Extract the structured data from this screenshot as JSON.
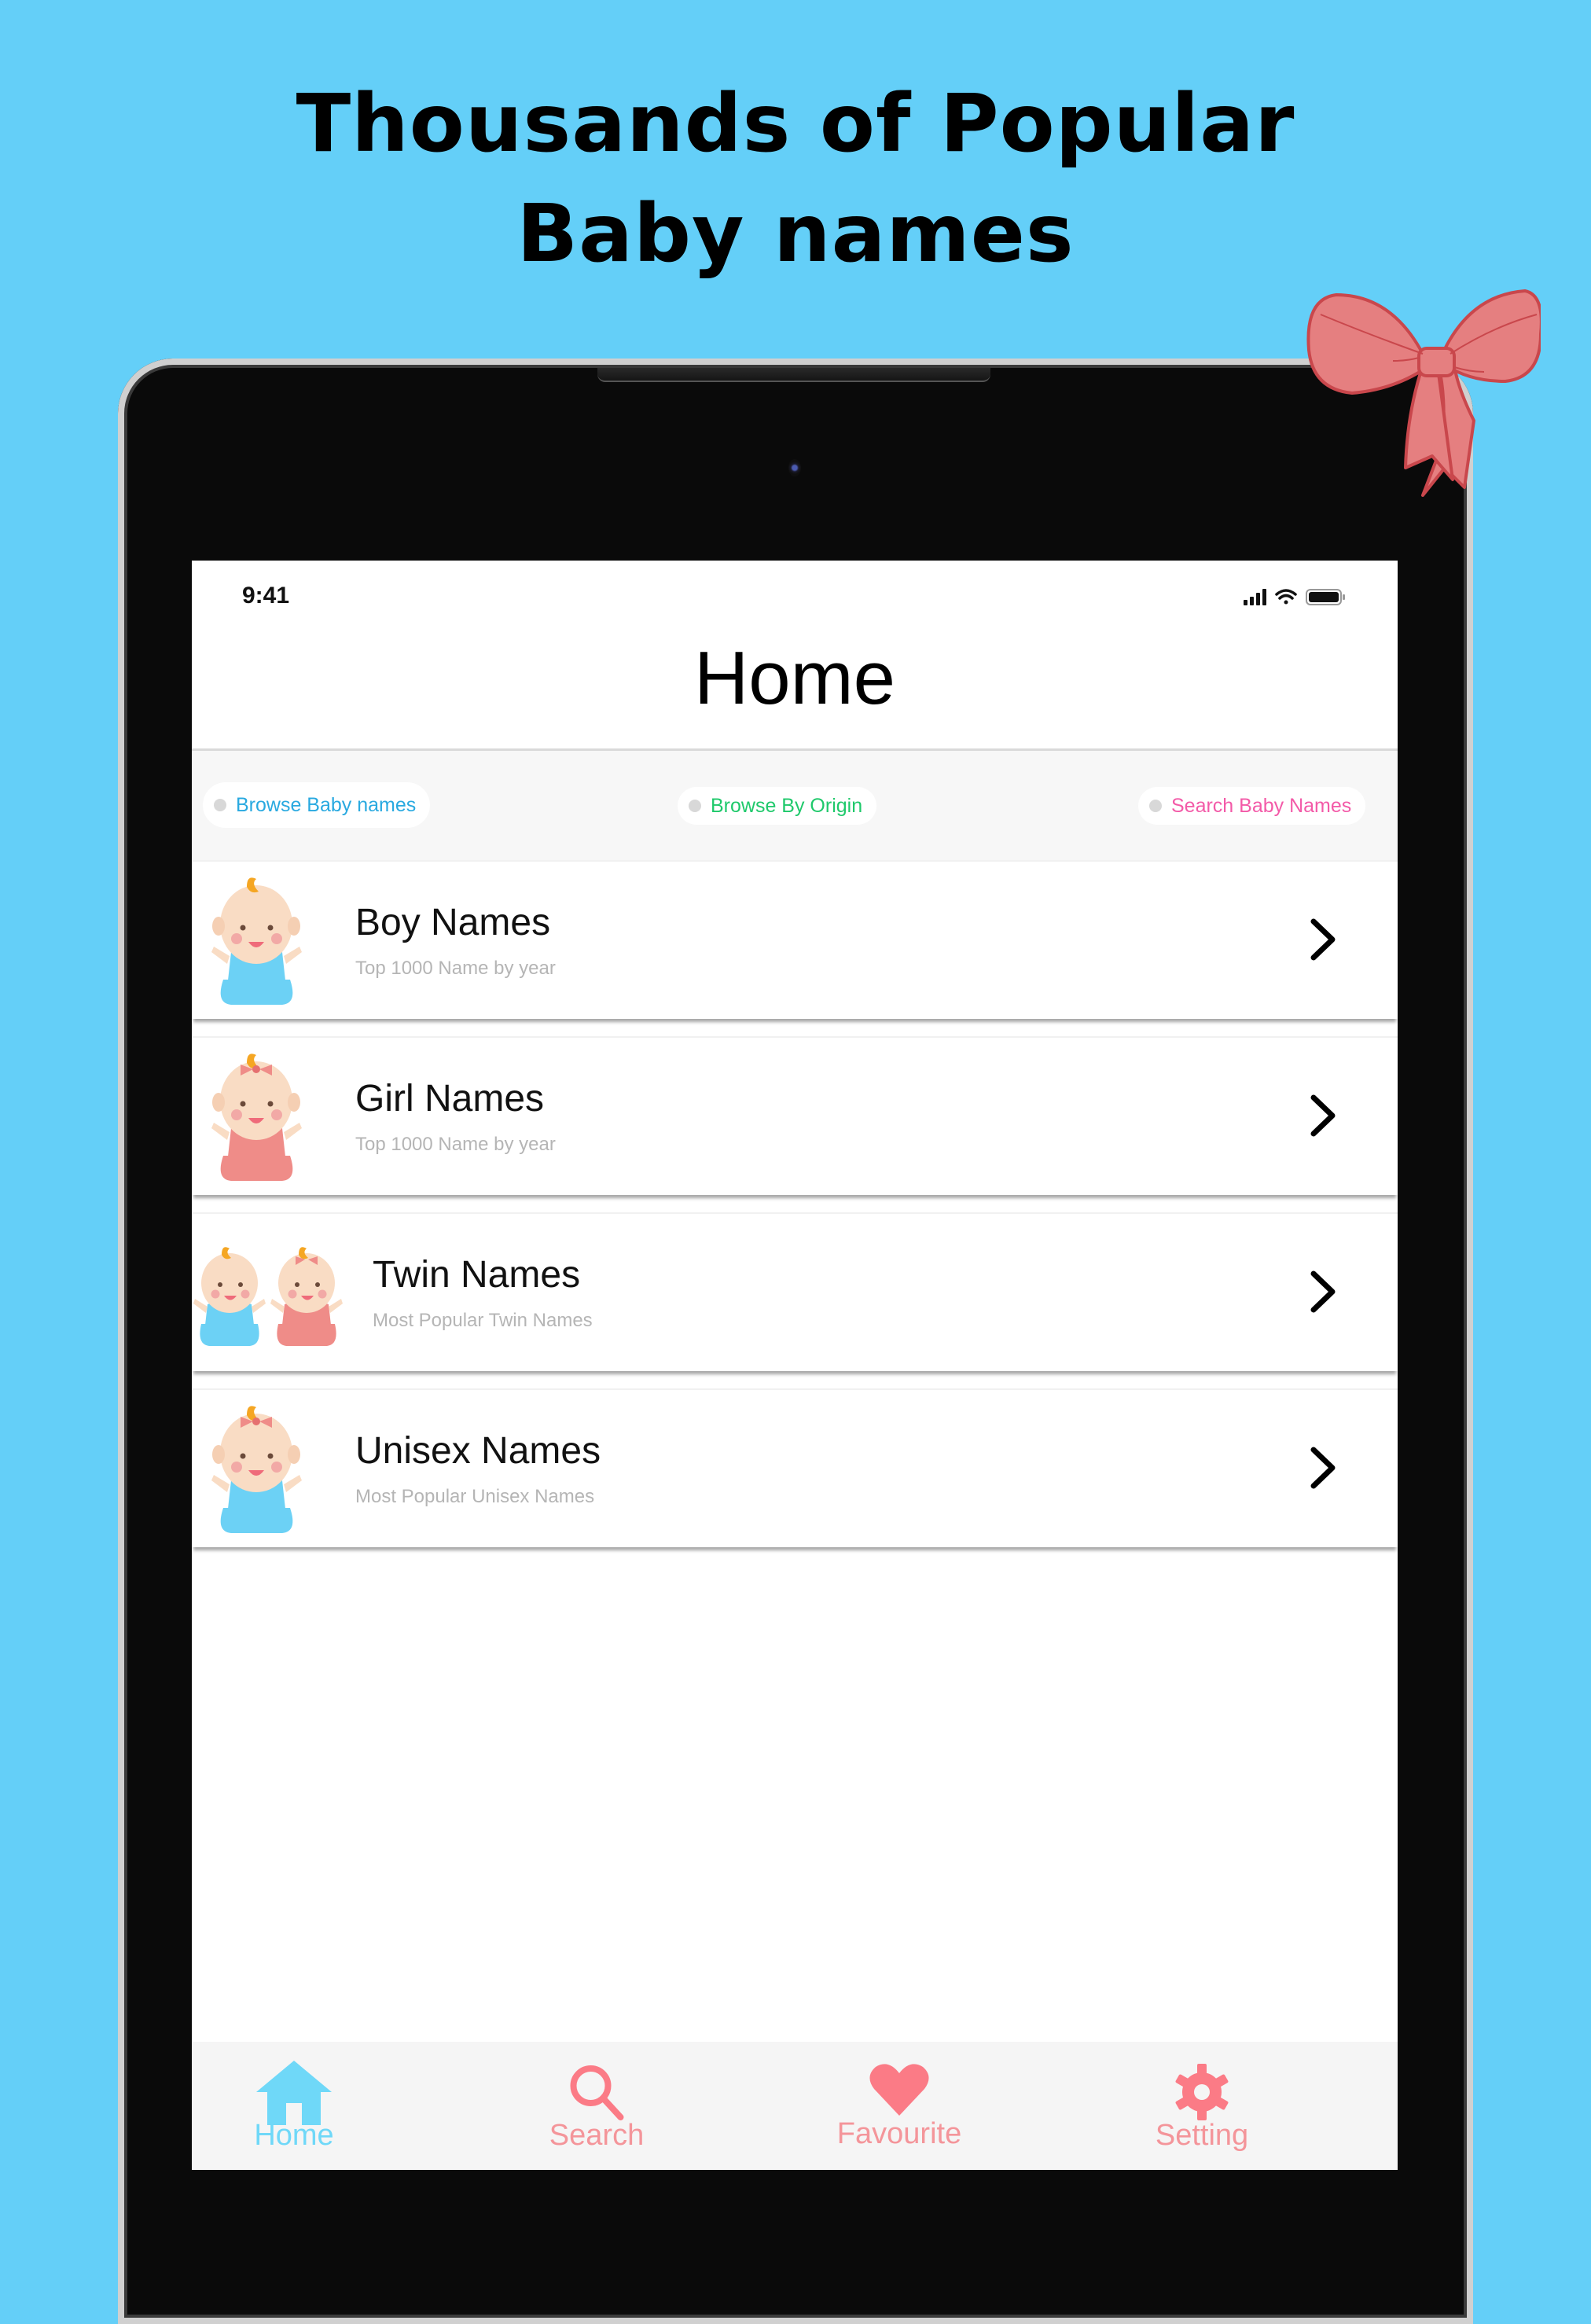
{
  "headline": {
    "line1": "Thousands of Popular",
    "line2": "Baby names"
  },
  "status_bar": {
    "time": "9:41",
    "icons": [
      "cellular-signal-icon",
      "wifi-icon",
      "battery-icon"
    ]
  },
  "nav": {
    "title": "Home"
  },
  "chips": [
    {
      "label": "Browse Baby names",
      "color": "#29a9e0"
    },
    {
      "label": "Browse By Origin",
      "color": "#1fc96b"
    },
    {
      "label": "Search Baby Names",
      "color": "#f35aa8"
    }
  ],
  "categories": [
    {
      "title": "Boy Names",
      "subtitle": "Top 1000 Name by year",
      "icon": "baby-boy-icon"
    },
    {
      "title": "Girl Names",
      "subtitle": "Top 1000 Name by year",
      "icon": "baby-girl-icon"
    },
    {
      "title": "Twin Names",
      "subtitle": "Most Popular Twin Names",
      "icon": "baby-twins-icon"
    },
    {
      "title": "Unisex Names",
      "subtitle": "Most Popular Unisex Names",
      "icon": "baby-unisex-icon"
    }
  ],
  "tabbar": {
    "active_color": "#6fd8f8",
    "inactive_color": "#fb7b86",
    "items": [
      {
        "label": "Home",
        "icon": "home-icon",
        "active": true
      },
      {
        "label": "Search",
        "icon": "search-icon",
        "active": false
      },
      {
        "label": "Favourite",
        "icon": "heart-icon",
        "active": false
      },
      {
        "label": "Setting",
        "icon": "gear-icon",
        "active": false
      }
    ]
  },
  "colors": {
    "background": "#64cff8",
    "bow": "#e57f80",
    "boy_outfit": "#6cd1f5",
    "girl_outfit": "#ef8c88"
  }
}
